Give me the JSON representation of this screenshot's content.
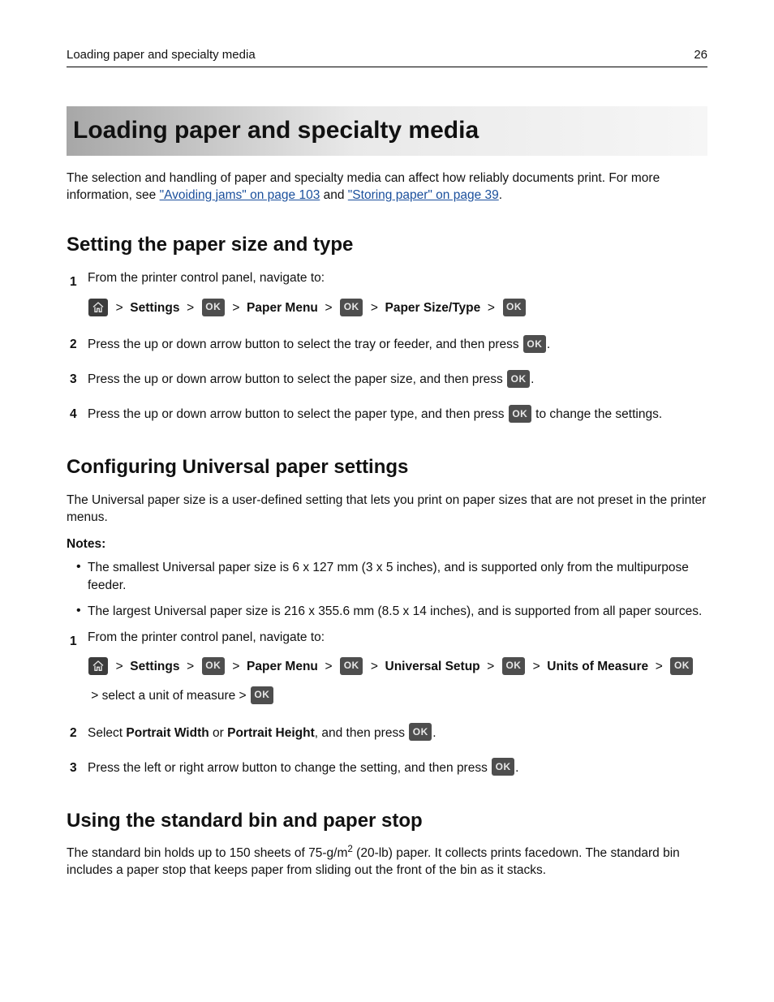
{
  "header": {
    "left": "Loading paper and specialty media",
    "right": "26"
  },
  "title": "Loading paper and specialty media",
  "intro": {
    "pre": "The selection and handling of paper and specialty media can affect how reliably documents print. For more information, see ",
    "link1": "\"Avoiding jams\" on page 103",
    "between": " and ",
    "link2": "\"Storing paper\" on page 39",
    "post": "."
  },
  "section1": {
    "heading": "Setting the paper size and type",
    "steps": {
      "s1_lead": "From the printer control panel, navigate to:",
      "nav": {
        "settings": "Settings",
        "paper_menu": "Paper Menu",
        "paper_size_type": "Paper Size/Type"
      },
      "s2_pre": "Press the up or down arrow button to select the tray or feeder, and then press ",
      "s2_post": ".",
      "s3_pre": "Press the up or down arrow button to select the paper size, and then press ",
      "s3_post": ".",
      "s4_pre": "Press the up or down arrow button to select the paper type, and then press ",
      "s4_post": " to change the settings."
    }
  },
  "section2": {
    "heading": "Configuring Universal paper settings",
    "intro": "The Universal paper size is a user‑defined setting that lets you print on paper sizes that are not preset in the printer menus.",
    "notes_label": "Notes:",
    "notes": {
      "n1": "The smallest Universal paper size is 6 x 127 mm (3 x 5 inches), and is supported only from the multipurpose feeder.",
      "n2": "The largest Universal paper size is 216 x 355.6 mm (8.5  x 14 inches), and is supported from all paper sources."
    },
    "steps": {
      "s1_lead": "From the printer control panel, navigate to:",
      "nav": {
        "settings": "Settings",
        "paper_menu": "Paper Menu",
        "universal_setup": "Universal Setup",
        "units": "Units of Measure",
        "tail_txt": " select a unit of measure ",
        "measure_prefix": "measure "
      },
      "s2_pre": "Select ",
      "s2_pw": "Portrait Width",
      "s2_or": " or ",
      "s2_ph": "Portrait Height",
      "s2_mid": ", and then press ",
      "s2_post": ".",
      "s3_pre": "Press the left or right arrow button to change the setting, and then press ",
      "s3_post": "."
    }
  },
  "section3": {
    "heading": "Using the standard bin and paper stop",
    "para": "The standard bin holds up to 150 sheets of 75‑g/m² (20‑lb) paper. It collects prints facedown. The standard bin includes a paper stop that keeps paper from sliding out of the front of the bin as it stacks.",
    "para_pre": "The standard bin holds up to 150 sheets of 75‑g/m",
    "para_sup": "2",
    "para_post": " (20‑lb) paper. It collects prints facedown. The standard bin includes a paper stop that keeps paper from sliding out the front of the bin as it stacks."
  },
  "icons": {
    "ok_label": "OK"
  }
}
